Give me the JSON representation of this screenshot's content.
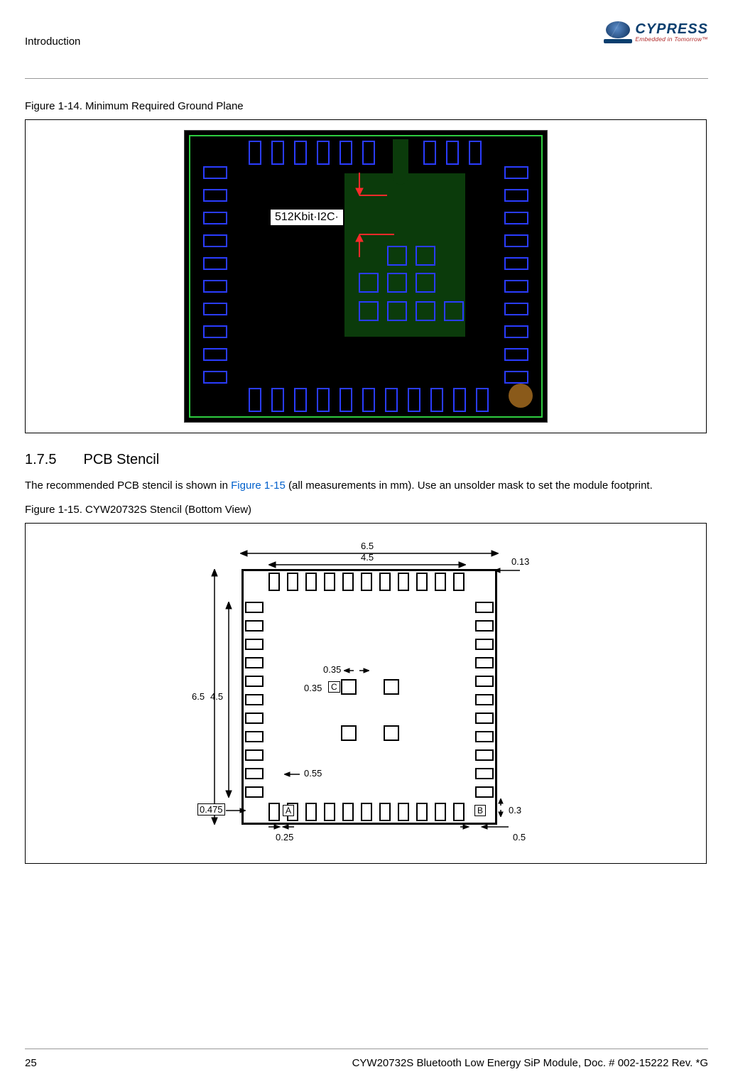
{
  "header": {
    "chapter": "Introduction",
    "logo_main": "CYPRESS",
    "logo_tag": "Embedded in Tomorrow™"
  },
  "fig14": {
    "caption": "Figure 1-14.  Minimum Required Ground Plane",
    "label": "512Kbit·I2C·"
  },
  "section": {
    "num": "1.7.5",
    "title": "PCB Stencil"
  },
  "para": {
    "pre": "The recommended PCB stencil is shown in ",
    "ref": "Figure 1-15",
    "post": " (all measurements in mm). Use an unsolder mask to set the module footprint."
  },
  "fig15": {
    "caption": "Figure 1-15.  CYW20732S Stencil (Bottom View)",
    "d65a": "6.5",
    "d45a": "4.5",
    "d013": "0.13",
    "d65b": "6.5",
    "d45b": "4.5",
    "d035a": "0.35",
    "d035b": "0.35",
    "c": "C",
    "a": "A",
    "b": "B",
    "d055": "0.55",
    "d0475": "0.475",
    "d025": "0.25",
    "d03": "0.3",
    "d05": "0.5"
  },
  "footer": {
    "page": "25",
    "doc": "CYW20732S Bluetooth Low Energy SiP Module, Doc. # 002-15222 Rev. *G"
  }
}
